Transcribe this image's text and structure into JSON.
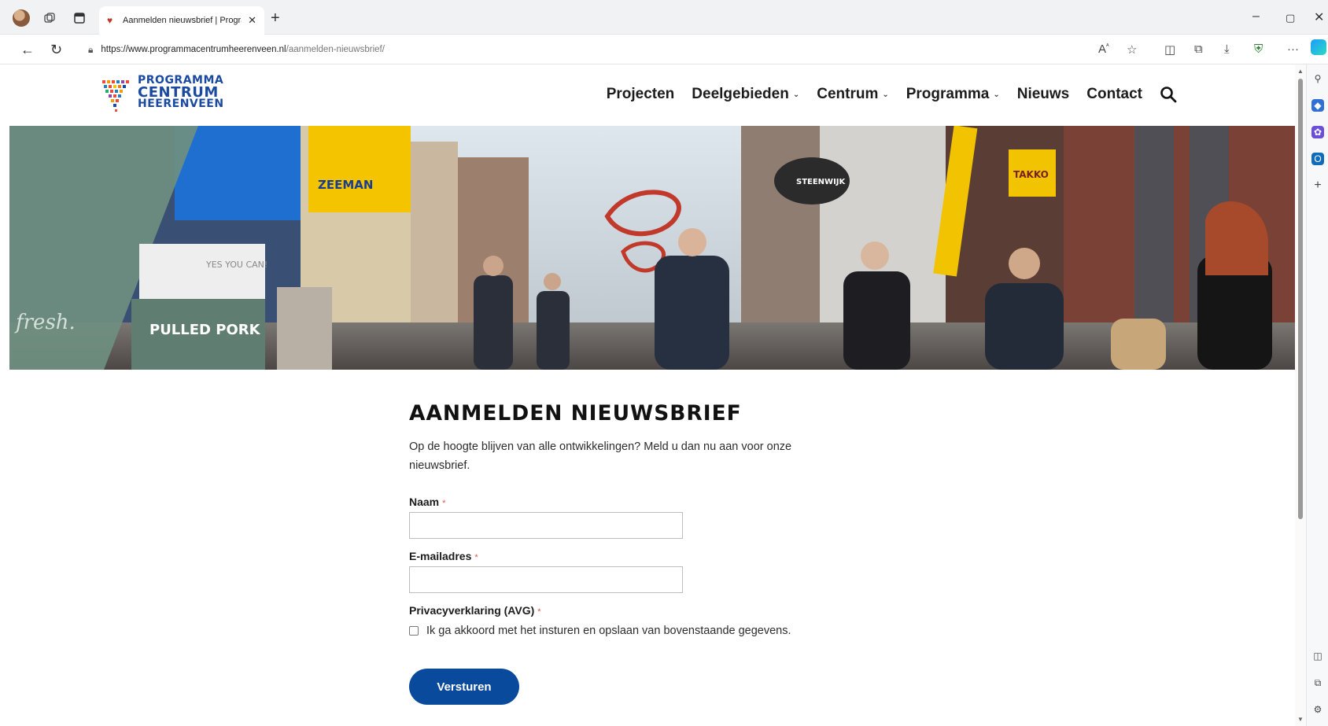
{
  "browser": {
    "tab_title": "Aanmelden nieuwsbrief | Progra",
    "url_host": "https://www.programmacentrumheerenveen.nl",
    "url_path": "/aanmelden-nieuwsbrief/"
  },
  "logo": {
    "line1": "PROGRAMMA",
    "line2": "CENTRUM",
    "line3": "HEERENVEEN"
  },
  "nav": {
    "items": [
      {
        "label": "Projecten",
        "dropdown": false
      },
      {
        "label": "Deelgebieden",
        "dropdown": true
      },
      {
        "label": "Centrum",
        "dropdown": true
      },
      {
        "label": "Programma",
        "dropdown": true
      },
      {
        "label": "Nieuws",
        "dropdown": false
      },
      {
        "label": "Contact",
        "dropdown": false
      }
    ]
  },
  "hero": {
    "signs": {
      "zeeman": "ZEEMAN",
      "steenwijk": "STEENWIJK",
      "takko": "TAKKO",
      "pulled_pork": "PULLED PORK",
      "fresh": "fresh.",
      "yes_you_can": "YES YOU CAN!"
    }
  },
  "form": {
    "title": "AANMELDEN NIEUWSBRIEF",
    "intro": "Op de hoogte blijven van alle ontwikkelingen? Meld u dan nu aan voor onze nieuwsbrief.",
    "name_label": "Naam",
    "email_label": "E-mailadres",
    "privacy_label": "Privacyverklaring (AVG)",
    "required_mark": "*",
    "name_value": "",
    "email_value": "",
    "consent_text": "Ik ga akkoord met het insturen en opslaan van bovenstaande gegevens.",
    "consent_checked": false,
    "submit_label": "Versturen"
  },
  "colors": {
    "brand_blue": "#0a4a9d",
    "logo_blue": "#1a4aa0",
    "required_red": "#d9534f"
  }
}
